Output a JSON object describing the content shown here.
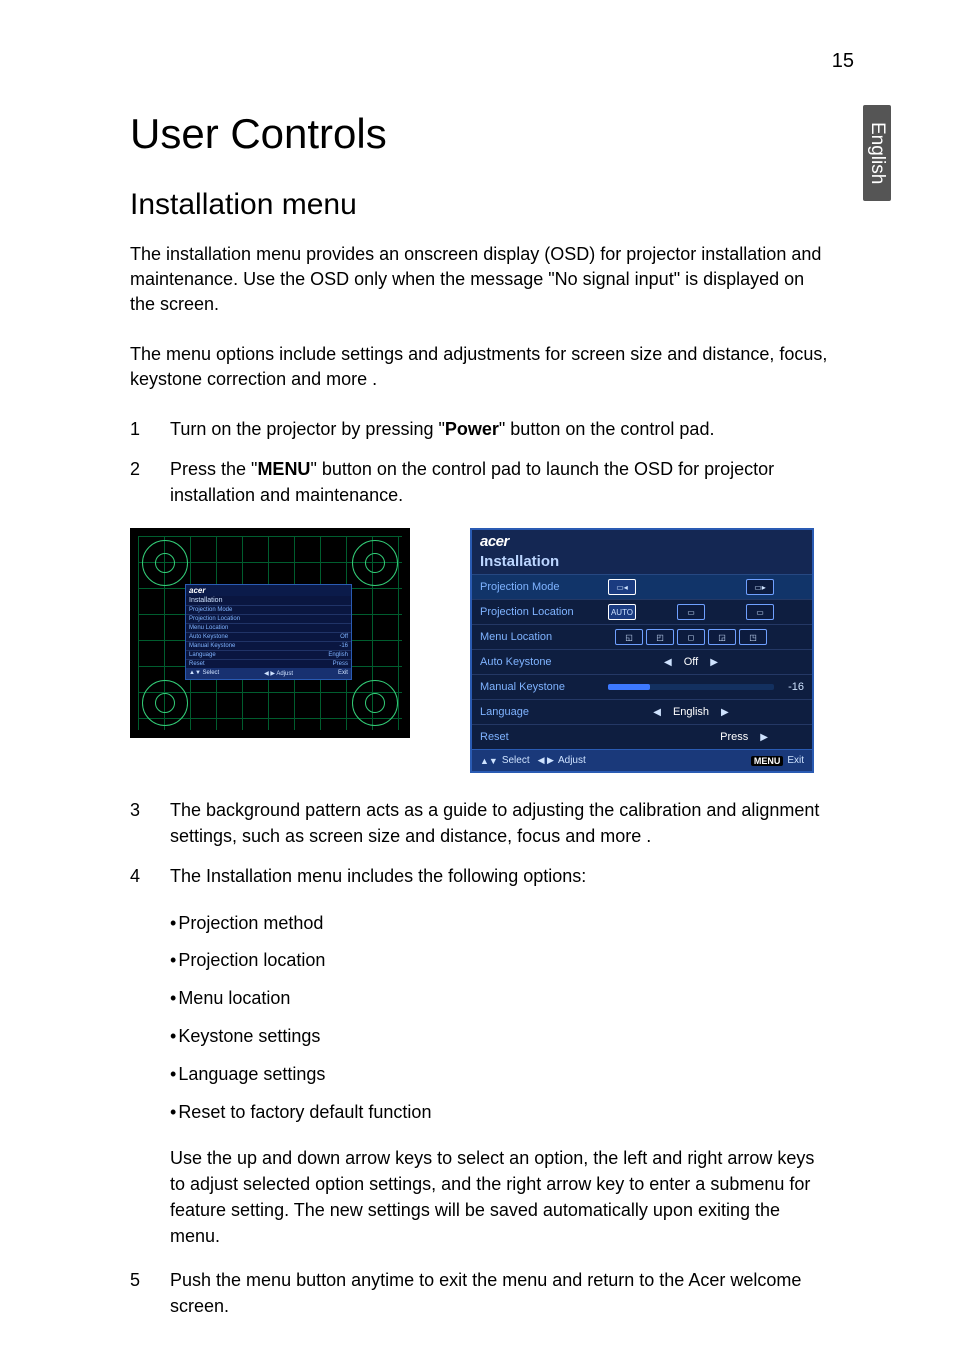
{
  "page_number": "15",
  "side_tab": "English",
  "title": "User Controls",
  "subtitle": "Installation menu",
  "intro": "The installation menu provides an onscreen display (OSD) for projector installation and maintenance. Use the OSD only when the message \"No signal input\" is displayed on the screen.",
  "lead": "The menu options include settings and adjustments for screen size and distance, focus, keystone correction and more .",
  "steps": {
    "s1": {
      "num": "1",
      "pre": "Turn on the projector by pressing \"",
      "bold": "Power",
      "post": "\" button on the control pad."
    },
    "s2": {
      "num": "2",
      "pre": "Press the \"",
      "bold": "MENU",
      "post": "\" button on the control pad to launch the OSD for projector installation and maintenance."
    },
    "s3": {
      "num": "3",
      "text": "The background pattern acts as a guide to adjusting the calibration and alignment settings, such as screen size and distance, focus and more ."
    },
    "s4": {
      "num": "4",
      "text": "The Installation menu includes the following options:"
    },
    "s5": {
      "num": "5",
      "text": "Push the menu button anytime to exit the menu and return to the Acer welcome screen."
    }
  },
  "bullets": {
    "b1": "Projection method",
    "b2": "Projection location",
    "b3": "Menu location",
    "b4": "Keystone settings",
    "b5": "Language settings",
    "b6": "Reset to factory default function"
  },
  "nav_text": "Use the up and down arrow keys to select an option, the left and right arrow keys to adjust selected option settings, and the right arrow key to enter a submenu for feature setting. The new settings will be saved automatically upon exiting the menu.",
  "osd": {
    "brand": "acer",
    "title": "Installation",
    "rows": {
      "proj_mode": {
        "label": "Projection Mode"
      },
      "proj_loc": {
        "label": "Projection Location",
        "auto": "AUTO"
      },
      "menu_loc": {
        "label": "Menu Location"
      },
      "auto_ks": {
        "label": "Auto Keystone",
        "value": "Off"
      },
      "man_ks": {
        "label": "Manual Keystone",
        "value": "-16"
      },
      "lang": {
        "label": "Language",
        "value": "English"
      },
      "reset": {
        "label": "Reset",
        "value": "Press"
      }
    },
    "footer": {
      "select": "Select",
      "adjust": "Adjust",
      "menu_badge": "MENU",
      "exit": "Exit"
    }
  },
  "mini": {
    "brand": "acer",
    "title": "Installation",
    "rows": {
      "r1": {
        "l": "Projection Mode",
        "r": ""
      },
      "r2": {
        "l": "Projection Location",
        "r": ""
      },
      "r3": {
        "l": "Menu Location",
        "r": ""
      },
      "r4": {
        "l": "Auto Keystone",
        "r": "Off"
      },
      "r5": {
        "l": "Manual Keystone",
        "r": "-16"
      },
      "r6": {
        "l": "Language",
        "r": "English"
      },
      "r7": {
        "l": "Reset",
        "r": "Press"
      }
    },
    "footer": {
      "select": "Select",
      "adjust": "Adjust",
      "exit": "Exit"
    }
  }
}
